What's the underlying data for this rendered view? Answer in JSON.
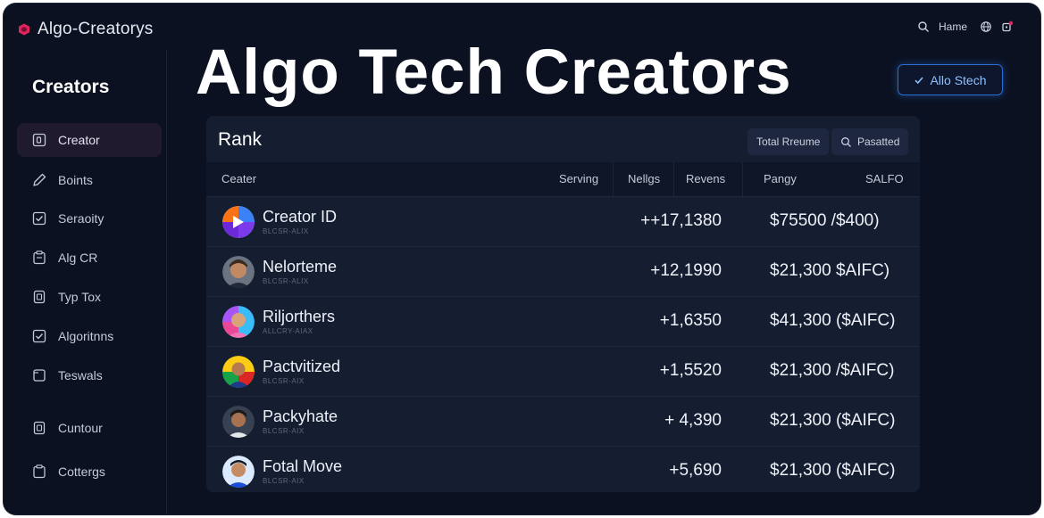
{
  "brand": {
    "name": "Algo-Creatorys",
    "accent": "#e0245e"
  },
  "topbar": {
    "home_label": "Hame"
  },
  "headline": "Algo Tech Creators",
  "cta_label": "Allo Stech",
  "sidebar": {
    "title": "Creators",
    "items": [
      {
        "label": "Creator",
        "icon": "id-card-icon"
      },
      {
        "label": "Boints",
        "icon": "pen-icon"
      },
      {
        "label": "Seraoity",
        "icon": "check-box-icon"
      },
      {
        "label": "Alg CR",
        "icon": "clipboard-icon"
      },
      {
        "label": "Typ Tox",
        "icon": "document-icon"
      },
      {
        "label": "Algoritnns",
        "icon": "check-box-icon"
      },
      {
        "label": "Teswals",
        "icon": "square-icon"
      },
      {
        "label": "Cuntour",
        "icon": "document-icon"
      },
      {
        "label": "Cottergs",
        "icon": "clipboard-icon"
      }
    ]
  },
  "panel": {
    "title": "Rank",
    "total_label": "Total Rreume",
    "search_label": "Pasatted",
    "columns": [
      "Ceater",
      "Serving",
      "Nellgs",
      "Revens",
      "Pangy",
      "SALFO"
    ],
    "rows": [
      {
        "name": "Creator ID",
        "sub": "BLCSR-ALIX",
        "growth": "++17,1380",
        "revenue": "$75500 /$400)"
      },
      {
        "name": "Nelorteme",
        "sub": "BLCSR-ALIX",
        "growth": "+12,1990",
        "revenue": "$21,300 $AIFC)"
      },
      {
        "name": "Riljorthers",
        "sub": "ALLCRY-AIAX",
        "growth": "+1,6350",
        "revenue": "$41,300 ($AIFC)"
      },
      {
        "name": "Pactvitized",
        "sub": "BLCSR-AIX",
        "growth": "+1,5520",
        "revenue": "$21,300 /$AIFC)"
      },
      {
        "name": "Packyhate",
        "sub": "BLCSR-AIX",
        "growth": "+ 4,390",
        "revenue": "$21,300 ($AIFC)"
      },
      {
        "name": "Fotal Move",
        "sub": "BLCSR-AIX",
        "growth": "+5,690",
        "revenue": "$21,300 ($AIFC)"
      }
    ]
  }
}
